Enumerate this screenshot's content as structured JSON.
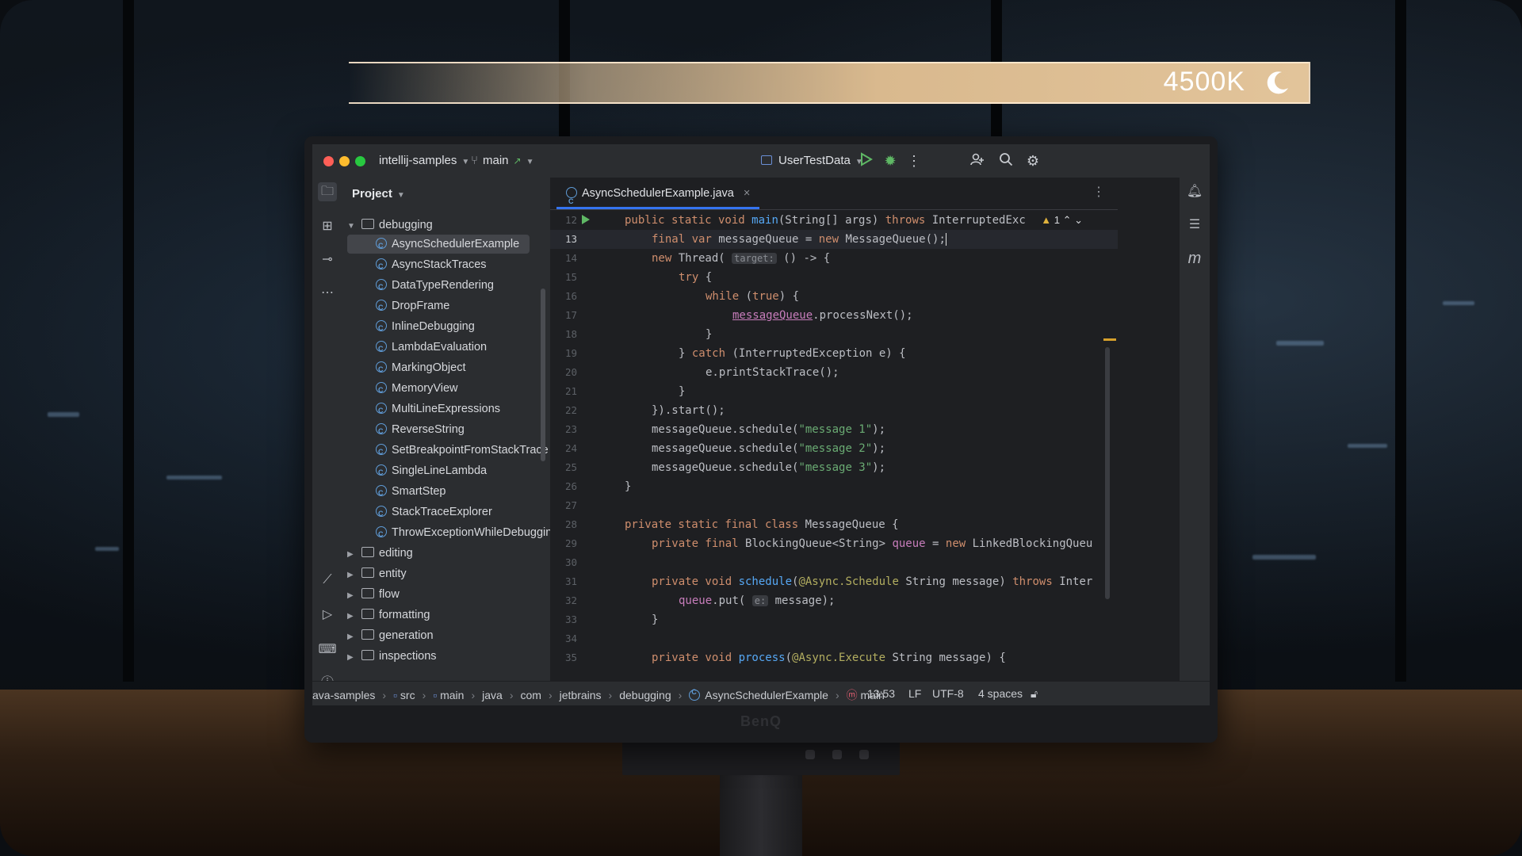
{
  "osd": {
    "color_temperature": "4500K",
    "mode_icon": "moon-icon"
  },
  "titlebar": {
    "project": "intellij-samples",
    "branch": "main",
    "run_config": "UserTestData"
  },
  "bezel": {
    "brand": "BenQ"
  },
  "project_panel": {
    "title": "Project",
    "root_folder": "debugging",
    "classes": [
      "AsyncSchedulerExample",
      "AsyncStackTraces",
      "DataTypeRendering",
      "DropFrame",
      "InlineDebugging",
      "LambdaEvaluation",
      "MarkingObject",
      "MemoryView",
      "MultiLineExpressions",
      "ReverseString",
      "SetBreakpointFromStackTrace",
      "SingleLineLambda",
      "SmartStep",
      "StackTraceExplorer",
      "ThrowExceptionWhileDebugging"
    ],
    "folders": [
      "editing",
      "entity",
      "flow",
      "formatting",
      "generation",
      "inspections"
    ]
  },
  "editor": {
    "tab": "AsyncSchedulerExample.java",
    "warning_count": "1",
    "line_numbers": [
      "12",
      "13",
      "14",
      "15",
      "16",
      "17",
      "18",
      "19",
      "20",
      "21",
      "22",
      "23",
      "24",
      "25",
      "26",
      "27",
      "28",
      "29",
      "30",
      "31",
      "32",
      "33",
      "34",
      "35"
    ],
    "hints": {
      "target": "target:",
      "e": "e:"
    }
  },
  "statusbar": {
    "breadcrumbs": [
      "ava-samples",
      "src",
      "main",
      "java",
      "com",
      "jetbrains",
      "debugging",
      "AsyncSchedulerExample",
      "main"
    ],
    "position": "13:53",
    "line_sep": "LF",
    "encoding": "UTF-8",
    "indent": "4 spaces"
  }
}
